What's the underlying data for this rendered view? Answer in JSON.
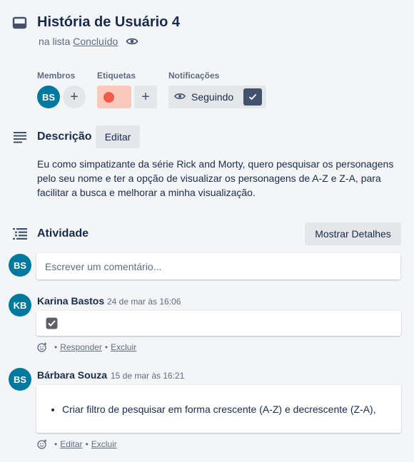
{
  "card": {
    "title": "História de Usuário 4",
    "in_list_prefix": "na lista",
    "list_name": "Concluído"
  },
  "members": {
    "label": "Membros",
    "initials": "BS",
    "add_symbol": "+"
  },
  "labels": {
    "label": "Etiquetas",
    "chip_color": "#f5594a",
    "add_symbol": "+"
  },
  "notifications": {
    "label": "Notificações",
    "button_label": "Seguindo"
  },
  "description": {
    "title": "Descrição",
    "edit_label": "Editar",
    "text": "Eu como simpatizante da série Rick and Morty, quero pesquisar os personagens pelo seu nome e ter a opção de visualizar os personagens de A-Z e Z-A, para facilitar a busca e melhorar a minha visualização."
  },
  "activity": {
    "title": "Atividade",
    "details_button": "Mostrar Detalhes",
    "current_user_initials": "BS",
    "comment_placeholder": "Escrever um comentário...",
    "comments": [
      {
        "initials": "KB",
        "author": "Karina Bastos",
        "date": "24 de mar às 16:06",
        "reply_label": "Responder",
        "delete_label": "Excluir",
        "separator": "•"
      },
      {
        "initials": "BS",
        "author": "Bárbara Souza",
        "date": "15 de mar às 16:21",
        "list_item": "Criar filtro de pesquisar em forma crescente (A-Z) e decrescente (Z-A),",
        "edit_label": "Editar",
        "delete_label": "Excluir",
        "separator": "•"
      }
    ]
  },
  "colors": {
    "avatar_bg": "#0079a0",
    "label_chip_bg": "#fdc8bc",
    "check_bg": "#42526e",
    "page_bg": "#f4f5f7"
  }
}
